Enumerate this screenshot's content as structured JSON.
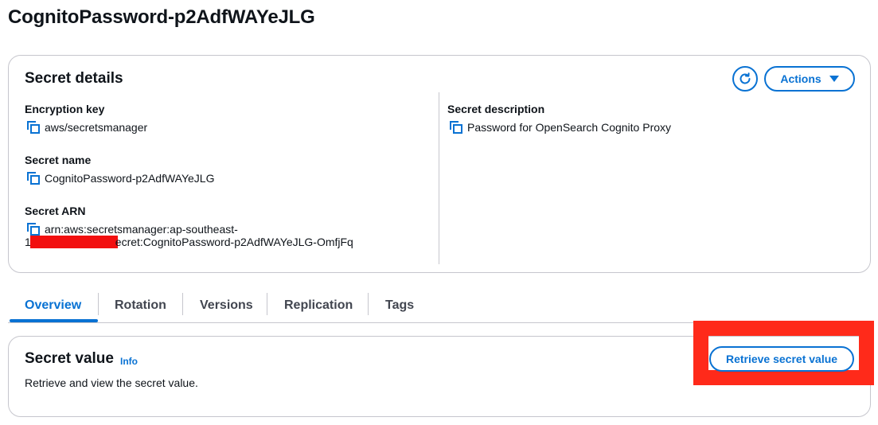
{
  "page": {
    "title": "CognitoPassword-p2AdfWAYeJLG"
  },
  "details": {
    "title": "Secret details",
    "actions_label": "Actions",
    "encryption_key": {
      "label": "Encryption key",
      "value": "aws/secretsmanager"
    },
    "secret_name": {
      "label": "Secret name",
      "value": "CognitoPassword-p2AdfWAYeJLG"
    },
    "secret_arn": {
      "label": "Secret ARN",
      "line1": "arn:aws:secretsmanager:ap-southeast-",
      "line2_prefix": "1",
      "line2_suffix": "ecret:CognitoPassword-p2AdfWAYeJLG-OmfjFq"
    },
    "secret_description": {
      "label": "Secret description",
      "value": "Password for OpenSearch Cognito Proxy"
    }
  },
  "tabs": [
    {
      "label": "Overview",
      "active": true
    },
    {
      "label": "Rotation",
      "active": false
    },
    {
      "label": "Versions",
      "active": false
    },
    {
      "label": "Replication",
      "active": false
    },
    {
      "label": "Tags",
      "active": false
    }
  ],
  "secret_value": {
    "title": "Secret value",
    "info_label": "Info",
    "description": "Retrieve and view the secret value.",
    "retrieve_label": "Retrieve secret value"
  },
  "colors": {
    "accent": "#0972d3",
    "highlight": "#ff2a1a",
    "redaction": "#f20f0f",
    "border": "#c6c6cd"
  },
  "icons": {
    "copy": "copy-icon",
    "refresh": "refresh-icon",
    "dropdown": "caret-down-icon"
  }
}
